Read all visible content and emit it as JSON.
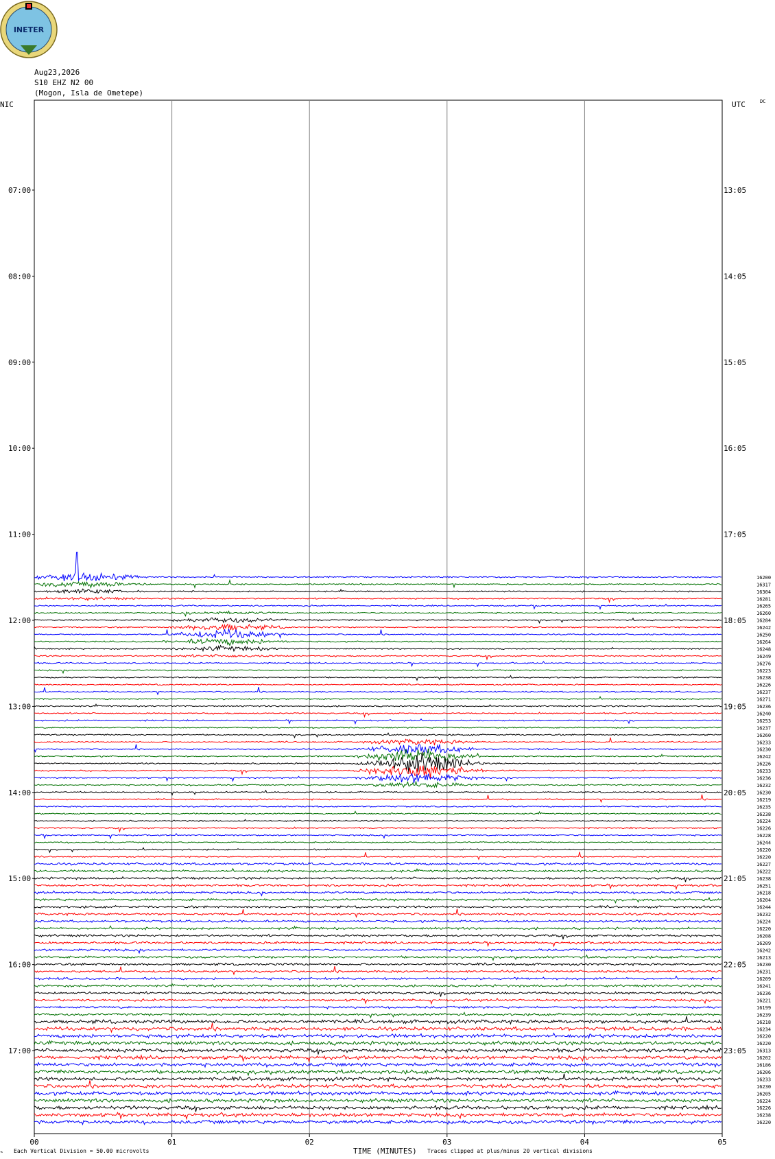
{
  "header": {
    "date": "Aug23,2026",
    "channel": "S10 EHZ N2 00",
    "station": "(Mogon, Isla de Ometepe)",
    "logo_text": "INETER"
  },
  "left_tz": "NIC",
  "right_tz": "UTC",
  "dc_label": "DC",
  "footer": {
    "scale": "Each Vertical Division =    50.00 microvolts",
    "xlabel": "TIME (MINUTES)",
    "clip_note": "Traces clipped at plus/minus 20 vertical divisions"
  },
  "colors": {
    "trace_cycle": [
      "#0000ff",
      "#007000",
      "#000000",
      "#ff0000"
    ],
    "grid": "#808080"
  },
  "chart_data": {
    "type": "line",
    "title": "",
    "xlabel": "TIME (MINUTES)",
    "x_ticks": [
      "00",
      "01",
      "02",
      "03",
      "04",
      "05"
    ],
    "xlim": [
      0,
      5
    ],
    "grid": true,
    "left_hour_labels": [
      "07:00",
      "08:00",
      "09:00",
      "10:00",
      "11:00",
      "12:00",
      "13:00",
      "14:00",
      "15:00",
      "16:00",
      "17:00"
    ],
    "right_hour_labels": [
      "13:05",
      "14:05",
      "15:05",
      "16:05",
      "17:05",
      "18:05",
      "19:05",
      "20:05",
      "21:05",
      "22:05",
      "23:05"
    ],
    "trace_start_row": 66,
    "trace_dc_values": [
      "16200",
      "16317",
      "16304",
      "16281",
      "16265",
      "16260",
      "16284",
      "16242",
      "16250",
      "16264",
      "16248",
      "16249",
      "16276",
      "16223",
      "16238",
      "16226",
      "16237",
      "16271",
      "16236",
      "16240",
      "16253",
      "16237",
      "16260",
      "16233",
      "16230",
      "16242",
      "16226",
      "16233",
      "16236",
      "16232",
      "16230",
      "16219",
      "16235",
      "16238",
      "16224",
      "16226",
      "16228",
      "16244",
      "16220",
      "16220",
      "16227",
      "16222",
      "16238",
      "16251",
      "16218",
      "16204",
      "16244",
      "16232",
      "16224",
      "16220",
      "16208",
      "16209",
      "16242",
      "16213",
      "16230",
      "16231",
      "16209",
      "16241",
      "16236",
      "16221",
      "16199",
      "16239",
      "16218",
      "16234",
      "16220",
      "16220",
      "16313",
      "16202",
      "16186",
      "16206",
      "16233",
      "16230",
      "16205",
      "16224",
      "16226",
      "16238",
      "16220"
    ],
    "events": [
      {
        "row": 66,
        "minute": 0.35,
        "note": "spike"
      },
      {
        "row": 74,
        "minute": 1.4,
        "note": "burst"
      },
      {
        "row": 92,
        "minute": 2.8,
        "note": "large burst"
      }
    ]
  }
}
